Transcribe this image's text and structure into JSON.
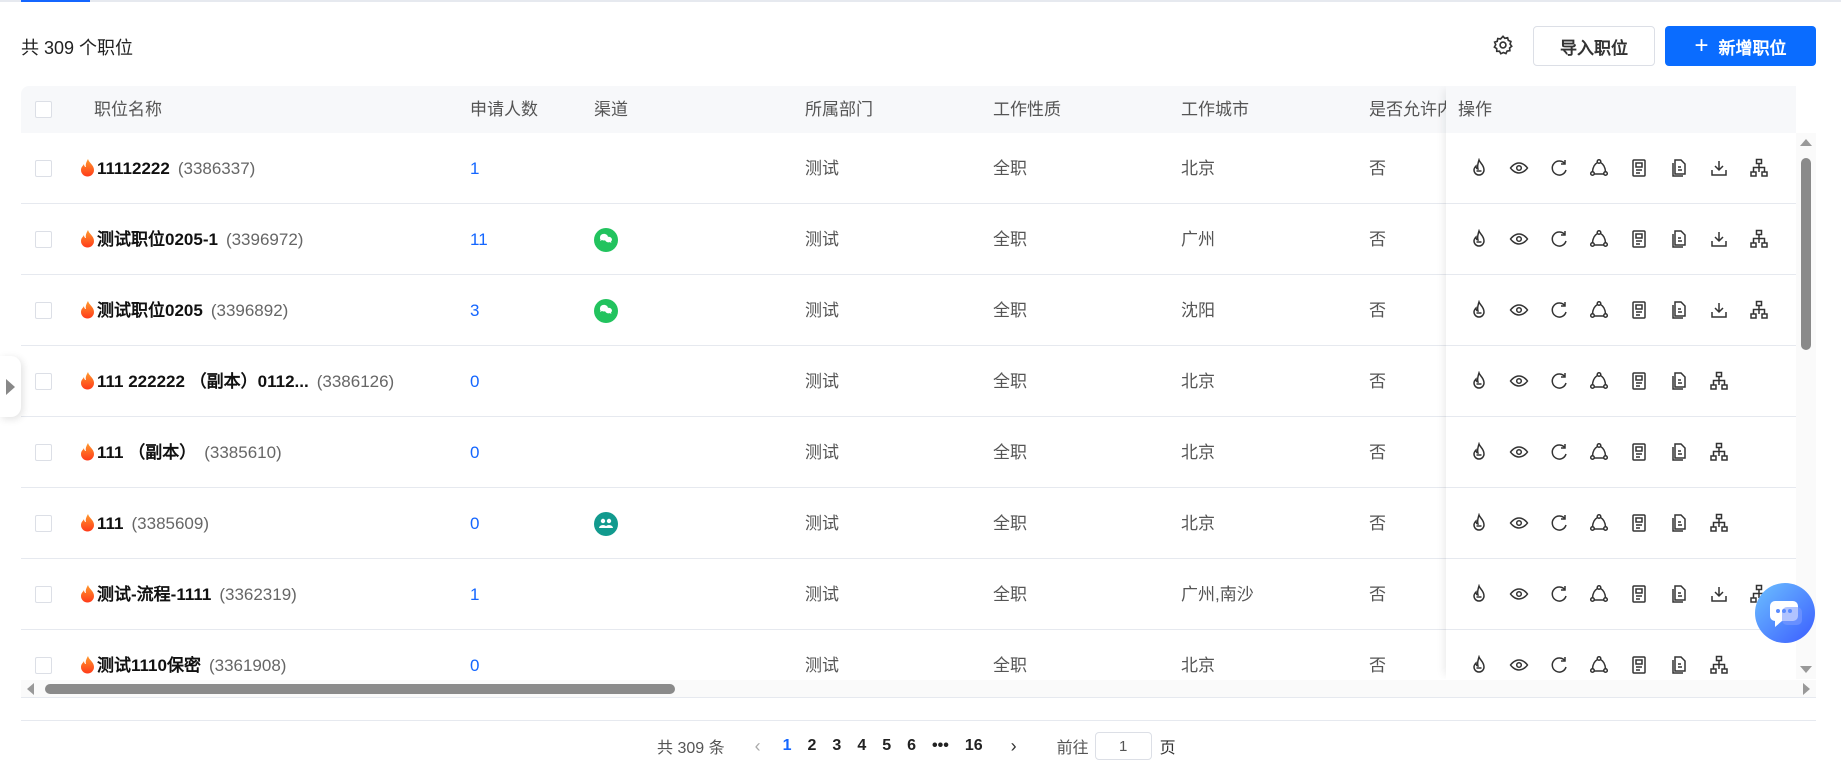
{
  "header": {
    "title": "共 309 个职位",
    "import_label": "导入职位",
    "new_label": "新增职位",
    "new_icon": "plus-icon",
    "settings_icon": "gear-icon"
  },
  "accent": "#0a6cff",
  "table": {
    "columns": [
      "职位名称",
      "申请人数",
      "渠道",
      "所属部门",
      "工作性质",
      "工作城市",
      "是否允许内",
      "操作"
    ],
    "action_icons": [
      "fire-icon",
      "eye-icon",
      "refresh-icon",
      "share-icon",
      "document-icon",
      "copy-document-icon",
      "download-icon",
      "org-chart-icon"
    ],
    "rows": [
      {
        "name": "11112222",
        "id": "(3386337)",
        "applicants": "1",
        "channel": "",
        "dept": "测试",
        "nature": "全职",
        "city": "北京",
        "allow": "否",
        "download": true
      },
      {
        "name": "测试职位0205-1",
        "id": "(3396972)",
        "applicants": "11",
        "channel": "wechat",
        "dept": "测试",
        "nature": "全职",
        "city": "广州",
        "allow": "否",
        "download": true
      },
      {
        "name": "测试职位0205",
        "id": "(3396892)",
        "applicants": "3",
        "channel": "wechat",
        "dept": "测试",
        "nature": "全职",
        "city": "沈阳",
        "allow": "否",
        "download": true
      },
      {
        "name": "111 222222 （副本）0112...",
        "id": "(3386126)",
        "applicants": "0",
        "channel": "",
        "dept": "测试",
        "nature": "全职",
        "city": "北京",
        "allow": "否",
        "download": false
      },
      {
        "name": "111 （副本）",
        "id": "(3385610)",
        "applicants": "0",
        "channel": "",
        "dept": "测试",
        "nature": "全职",
        "city": "北京",
        "allow": "否",
        "download": false
      },
      {
        "name": "111",
        "id": "(3385609)",
        "applicants": "0",
        "channel": "group",
        "dept": "测试",
        "nature": "全职",
        "city": "北京",
        "allow": "否",
        "download": false
      },
      {
        "name": "测试-流程-1111",
        "id": "(3362319)",
        "applicants": "1",
        "channel": "",
        "dept": "测试",
        "nature": "全职",
        "city": "广州,南沙",
        "allow": "否",
        "download": true
      },
      {
        "name": "测试1110保密",
        "id": "(3361908)",
        "applicants": "0",
        "channel": "",
        "dept": "测试",
        "nature": "全职",
        "city": "北京",
        "allow": "否",
        "download": false
      }
    ]
  },
  "pagination": {
    "total": "共 309 条",
    "pages": [
      "1",
      "2",
      "3",
      "4",
      "5",
      "6",
      "•••",
      "16"
    ],
    "current": "1",
    "goto_label": "前往",
    "goto_value": "1",
    "page_suffix": "页"
  }
}
